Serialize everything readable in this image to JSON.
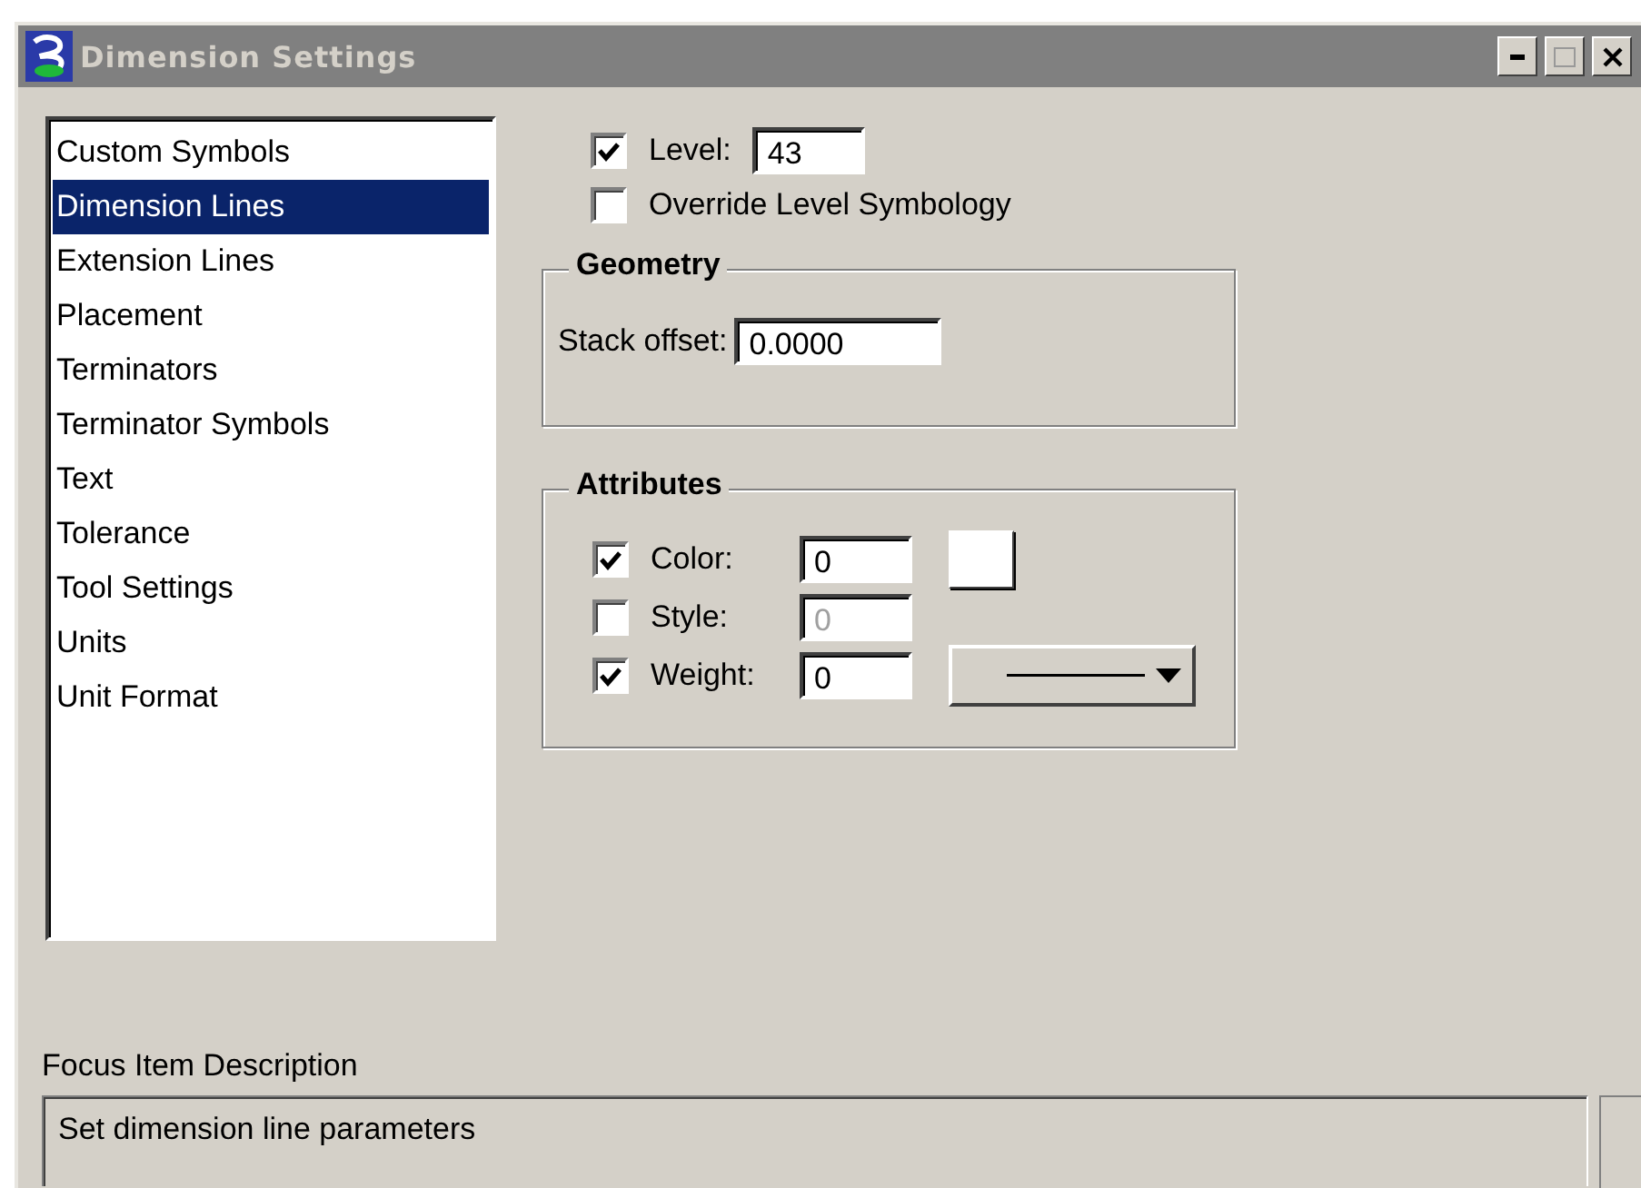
{
  "window": {
    "title": "Dimension Settings"
  },
  "categories": [
    {
      "label": "Custom Symbols",
      "selected": false
    },
    {
      "label": "Dimension Lines",
      "selected": true
    },
    {
      "label": "Extension Lines",
      "selected": false
    },
    {
      "label": "Placement",
      "selected": false
    },
    {
      "label": "Terminators",
      "selected": false
    },
    {
      "label": "Terminator Symbols",
      "selected": false
    },
    {
      "label": "Text",
      "selected": false
    },
    {
      "label": "Tolerance",
      "selected": false
    },
    {
      "label": "Tool Settings",
      "selected": false
    },
    {
      "label": "Units",
      "selected": false
    },
    {
      "label": "Unit Format",
      "selected": false
    }
  ],
  "level": {
    "label": "Level:",
    "checked": true,
    "value": "43"
  },
  "override": {
    "label": "Override Level Symbology",
    "checked": false
  },
  "geometry": {
    "title": "Geometry",
    "stack_offset": {
      "label": "Stack offset:",
      "value": "0.0000"
    }
  },
  "attributes": {
    "title": "Attributes",
    "rows": [
      {
        "kind": "color",
        "label": "Color:",
        "checked": true,
        "value": "0",
        "disabled": false
      },
      {
        "kind": "style",
        "label": "Style:",
        "checked": false,
        "value": "0",
        "disabled": true
      },
      {
        "kind": "weight",
        "label": "Weight:",
        "checked": true,
        "value": "0",
        "disabled": false
      }
    ]
  },
  "focus": {
    "label": "Focus Item Description",
    "text": "Set dimension line parameters"
  }
}
